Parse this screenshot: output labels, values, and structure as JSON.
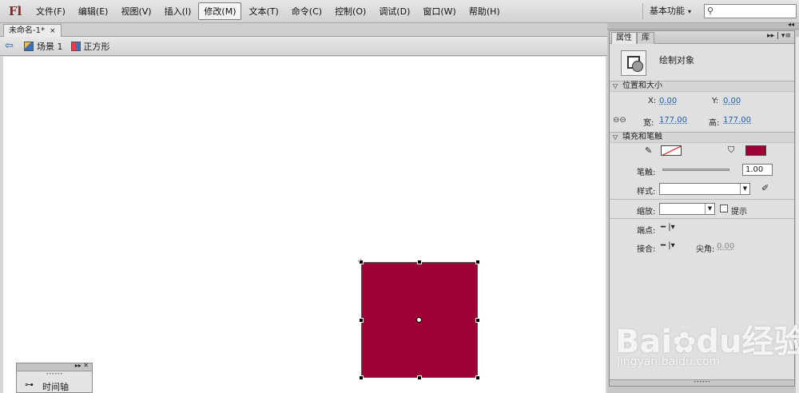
{
  "menubar": {
    "logo": "Fl",
    "items": [
      "文件(F)",
      "编辑(E)",
      "视图(V)",
      "插入(I)",
      "修改(M)",
      "文本(T)",
      "命令(C)",
      "控制(O)",
      "调试(D)",
      "窗口(W)",
      "帮助(H)"
    ],
    "active_index": 4,
    "workspace": "基本功能",
    "search_value": ""
  },
  "document_tab": {
    "label": "未命名-1*",
    "close": "×"
  },
  "breadcrumb": {
    "scene": "场景 1",
    "symbol": "正方形"
  },
  "stage": {
    "background": "#ffffff",
    "shape_fill": "#9b0036"
  },
  "properties": {
    "tabs": [
      "属性",
      "库"
    ],
    "object_type": "绘制对象",
    "pos_section": "位置和大小",
    "x_label": "X:",
    "x_value": "0.00",
    "y_label": "Y:",
    "y_value": "0.00",
    "w_label": "宽:",
    "w_value": "177.00",
    "h_label": "高:",
    "h_value": "177.00",
    "fill_section": "填充和笔触",
    "fill_color": "#9b0036",
    "stroke_label": "笔触:",
    "stroke_value": "1.00",
    "style_label": "样式:",
    "scale_label": "缩放:",
    "hint_label": "提示",
    "cap_label": "端点:",
    "join_label": "接合:",
    "miter_label": "尖角:",
    "miter_value": "0.00"
  },
  "timeline": {
    "label": "时间轴"
  },
  "watermark": {
    "brand": "Bai",
    "brand2": "du",
    "cn": "经验",
    "url": "jingyan.baidu.com"
  },
  "icons": [
    "back-arrow-icon",
    "scene-icon",
    "symbol-icon",
    "search-icon",
    "pencil-icon",
    "paint-bucket-icon",
    "eyedropper-icon",
    "link-icon",
    "timeline-icon",
    "drawing-object-icon"
  ]
}
